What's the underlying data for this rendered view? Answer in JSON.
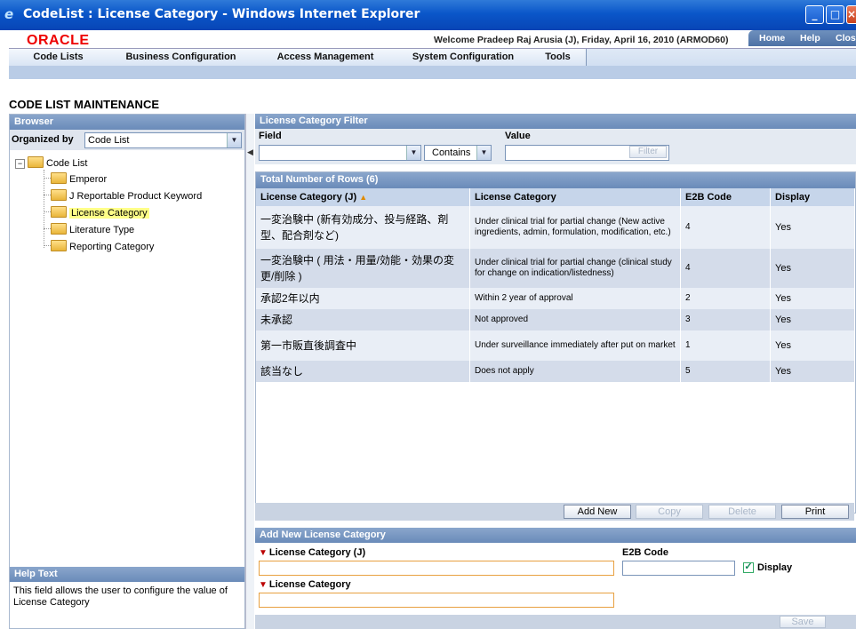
{
  "window": {
    "title": "CodeList : License Category - Windows Internet Explorer"
  },
  "header": {
    "logo": "ORACLE",
    "welcome": "Welcome Pradeep Raj Arusia (J), Friday, April 16, 2010 (ARMOD60)",
    "links": [
      "Home",
      "Help",
      "Close"
    ]
  },
  "menu": [
    "Code Lists",
    "Business Configuration",
    "Access Management",
    "System Configuration",
    "Tools"
  ],
  "page": {
    "title": "CODE LIST MAINTENANCE"
  },
  "browser": {
    "header": "Browser",
    "organized_by_label": "Organized by",
    "organized_by_value": "Code List",
    "root": "Code List",
    "items": [
      "Emperor",
      "J Reportable Product Keyword",
      "License Category",
      "Literature Type",
      "Reporting Category"
    ],
    "selected": "License Category"
  },
  "help": {
    "header": "Help Text",
    "text": "This field allows the user to configure the value of License Category"
  },
  "filter": {
    "header": "License Category Filter",
    "field_label": "Field",
    "value_label": "Value",
    "field_value": "",
    "operator": "Contains",
    "value": "",
    "button": "Filter"
  },
  "grid": {
    "total_rows": "Total Number of Rows (6)",
    "columns": [
      "License Category (J)",
      "License Category",
      "E2B Code",
      "Display"
    ],
    "rows": [
      [
        "一変治験中 (新有効成分、投与経路、剤型、配合剤など)",
        "Under clinical trial for partial change (New active ingredients, admin, formulation, modification, etc.)",
        "4",
        "Yes"
      ],
      [
        "一変治験中 ( 用法・用量/効能・効果の変更/削除 )",
        "Under clinical trial for partial change (clinical study for change on indication/listedness)",
        "4",
        "Yes"
      ],
      [
        "承認2年以内",
        "Within 2 year of approval",
        "2",
        "Yes"
      ],
      [
        "未承認",
        "Not approved",
        "3",
        "Yes"
      ],
      [
        "第一市販直後調査中",
        "Under surveillance immediately after put on market",
        "1",
        "Yes"
      ],
      [
        "該当なし",
        "Does not apply",
        "5",
        "Yes"
      ]
    ],
    "buttons": [
      "Add New",
      "Copy",
      "Delete",
      "Print"
    ]
  },
  "add_panel": {
    "header": "Add New License Category",
    "field_j_label": "License Category (J)",
    "e2b_label": "E2B Code",
    "display_label": "Display",
    "field_label": "License Category",
    "save": "Save"
  },
  "colors": {
    "accent": "#6a8bb9",
    "brand": "#e00000",
    "required_border": "#e8a040"
  }
}
